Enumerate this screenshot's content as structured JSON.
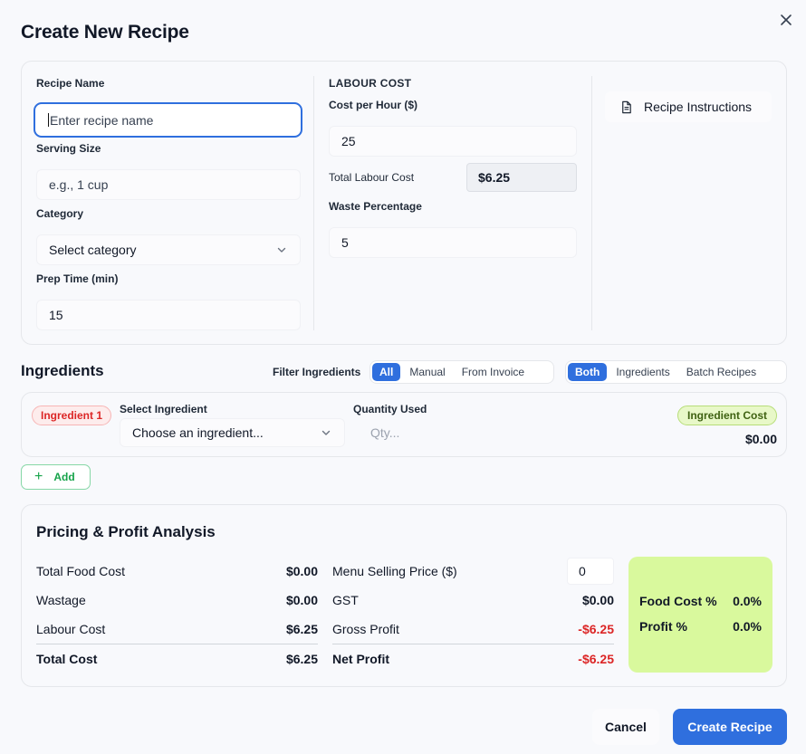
{
  "modal": {
    "title": "Create New Recipe",
    "close_label": ""
  },
  "recipe": {
    "name_label": "Recipe Name",
    "name_placeholder": "Enter recipe name",
    "serving_label": "Serving Size",
    "serving_placeholder": "e.g., 1 cup",
    "category_label": "Category",
    "category_selected": "Select category",
    "prep_label": "Prep Time (min)",
    "prep_value": "15"
  },
  "labour": {
    "heading": "LABOUR COST",
    "cost_per_hour_label": "Cost per Hour ($)",
    "cost_per_hour_value": "25",
    "total_label": "Total Labour Cost",
    "total_value": "$6.25",
    "waste_label": "Waste Percentage",
    "waste_value": "5"
  },
  "instructions_button": "Recipe Instructions",
  "ingredients": {
    "title": "Ingredients",
    "filter_label": "Filter Ingredients",
    "filter_source": [
      "All",
      "Manual",
      "From Invoice"
    ],
    "filter_type": [
      "Both",
      "Ingredients",
      "Batch Recipes"
    ],
    "active_source": "All",
    "active_type": "Both",
    "row": {
      "badge": "Ingredient 1",
      "select_label": "Select Ingredient",
      "select_placeholder": "Choose an ingredient...",
      "quantity_label": "Quantity Used",
      "quantity_placeholder": "Qty...",
      "cost_badge": "Ingredient Cost",
      "cost_value": "$0.00"
    },
    "add_label": "Add"
  },
  "pricing": {
    "title": "Pricing & Profit Analysis",
    "left": [
      {
        "label": "Total Food Cost",
        "value": "$0.00"
      },
      {
        "label": "Wastage",
        "value": "$0.00"
      },
      {
        "label": "Labour Cost",
        "value": "$6.25"
      },
      {
        "label": "Total Cost",
        "value": "$6.25"
      }
    ],
    "right": {
      "selling_label": "Menu Selling Price ($)",
      "selling_value": "0",
      "gst_label": "GST",
      "gst_value": "$0.00",
      "gross_label": "Gross Profit",
      "gross_value": "-$6.25",
      "net_label": "Net Profit",
      "net_value": "-$6.25"
    },
    "summary": {
      "food_cost_label": "Food Cost %",
      "food_cost_value": "0.0%",
      "profit_label": "Profit %",
      "profit_value": "0.0%"
    }
  },
  "footer": {
    "cancel": "Cancel",
    "create": "Create Recipe"
  },
  "colors": {
    "primary": "#2f6fde",
    "negative": "#dc2626",
    "summary_bg": "#d9f99d",
    "add_green": "#16a34a"
  }
}
